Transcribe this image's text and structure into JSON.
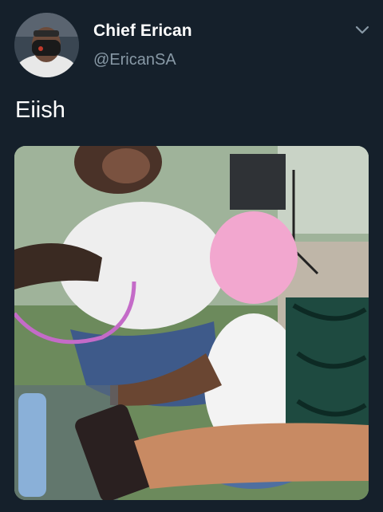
{
  "tweet": {
    "author_name": "Chief Erican",
    "author_handle": "@EricanSA",
    "text": "Eiish"
  },
  "icons": {
    "avatar": "profile-photo",
    "menu": "chevron-down-icon"
  },
  "colors": {
    "background": "#15202b",
    "primary_text": "#ffffff",
    "secondary_text": "#8899a6"
  }
}
